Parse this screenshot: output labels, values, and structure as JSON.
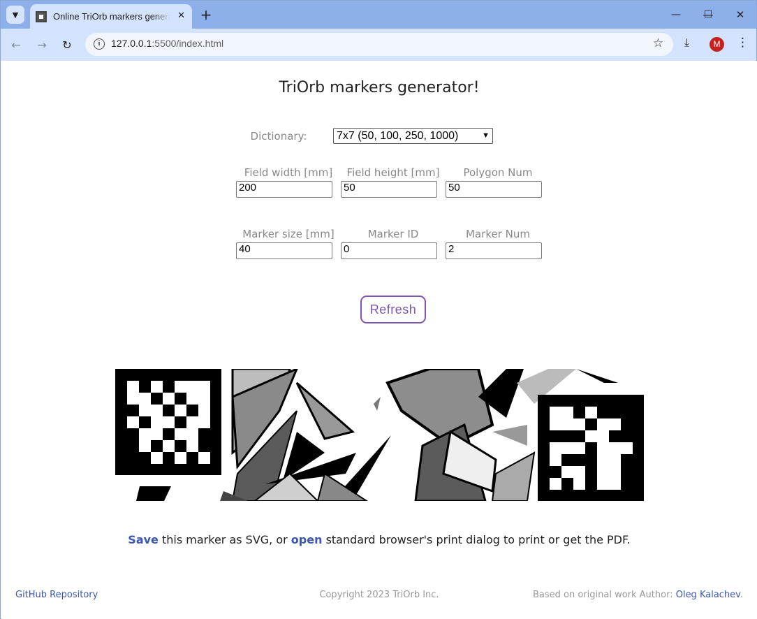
{
  "browser": {
    "tab_title": "Online TriOrb markers generator",
    "tab_close_glyph": "✕",
    "new_tab_glyph": "+",
    "url_host": "127.0.0.1",
    "url_path": ":5500/index.html",
    "profile_initial": "M",
    "window_buttons": [
      "—",
      "☐",
      "✕"
    ]
  },
  "page": {
    "title": "TriOrb markers generator!",
    "dictionary_label": "Dictionary:",
    "dictionary_value": "7x7 (50, 100, 250, 1000)",
    "fields_row1": [
      {
        "label": "Field width [mm]",
        "value": "200"
      },
      {
        "label": "Field height [mm]",
        "value": "50"
      },
      {
        "label": "Polygon Num",
        "value": "50"
      }
    ],
    "fields_row2": [
      {
        "label": "Marker size [mm]",
        "value": "40"
      },
      {
        "label": "Marker ID",
        "value": "0"
      },
      {
        "label": "Marker Num",
        "value": "2"
      }
    ],
    "refresh_label": "Refresh",
    "save_link": "Save",
    "save_text_1": " this marker as SVG, or ",
    "open_link": "open",
    "save_text_2": " standard browser's print dialog to print or get the PDF."
  },
  "footer": {
    "github": "GitHub Repository",
    "copyright": "Copyright 2023 TriOrb Inc.",
    "based_on": "Based on original work Author: ",
    "author": "Oleg Kalachev",
    "author_suffix": "."
  }
}
